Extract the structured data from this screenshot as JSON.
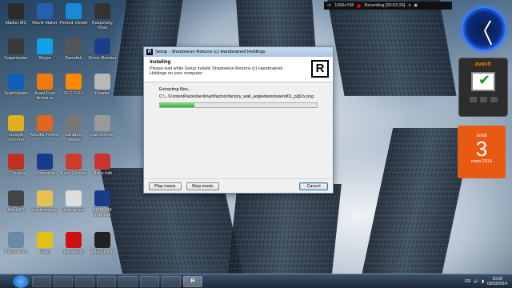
{
  "desktop": {
    "icons": [
      {
        "label": "Madou MC",
        "color": "#2a2a2a"
      },
      {
        "label": "Movie Maker",
        "color": "#2560b0"
      },
      {
        "label": "Pinned Viewer",
        "color": "#1a8ad8"
      },
      {
        "label": "Kaspersky Virus",
        "color": "#333333"
      },
      {
        "label": "Sagamaster",
        "color": "#3a3a3a"
      },
      {
        "label": "Skype",
        "color": "#14a0e8"
      },
      {
        "label": "Ramdisk",
        "color": "#555555"
      },
      {
        "label": "Driver Booster",
        "color": "#1b3e8a"
      },
      {
        "label": "TeamViewer",
        "color": "#0e5fb8"
      },
      {
        "label": "Avast Free Antivirus",
        "color": "#f07a10"
      },
      {
        "label": "VLC 2.0.1",
        "color": "#ff8800"
      },
      {
        "label": "Reader",
        "color": "#b8b8b8"
      },
      {
        "label": "Google Chrome",
        "color": "#e0b020"
      },
      {
        "label": "Mozilla Firefox",
        "color": "#e0661a"
      },
      {
        "label": "Sandbox Studio",
        "color": "#777777"
      },
      {
        "label": "manoforever",
        "color": "#999999"
      },
      {
        "label": "CCleaner",
        "color": "#c03020"
      },
      {
        "label": "Photoshop",
        "color": "#1a3a8a"
      },
      {
        "label": "Mario Forever",
        "color": "#d03a2a"
      },
      {
        "label": "Mario Info",
        "color": "#cc3333"
      },
      {
        "label": "UltraISO",
        "color": "#444444"
      },
      {
        "label": "for download",
        "color": "#e8c050"
      },
      {
        "label": "des compte",
        "color": "#dddddd"
      },
      {
        "label": "EMBLEM logo.psd",
        "color": "#1a3a8a"
      },
      {
        "label": "Recycle Bin",
        "color": "#6a8aa8"
      },
      {
        "label": "Fraps",
        "color": "#e0c010"
      },
      {
        "label": "Bandicam",
        "color": "#d01010"
      },
      {
        "label": "WELCOME",
        "color": "#222222"
      }
    ]
  },
  "recording": {
    "resolution": "1366x768",
    "status": "Recording [00:02:26]"
  },
  "calendar": {
    "day": "lundi",
    "date": "3",
    "month_year": "mars 2014"
  },
  "avast": {
    "brand": "avast!"
  },
  "installer": {
    "title": "Setup - Shadowrun Returns (c) Harebrained Holdings",
    "logo": "R",
    "header_title": "Installing",
    "header_subtitle": "Please wait while Setup installs Shadowrun Returns (c) Harebrained Holdings on your computer.",
    "status": "Extracting files...",
    "path": "C:\\...\\ContentPacks\\berlin\\art\\factory\\factory_wall_angledwindowend01_p@2x.png",
    "progress": 0.22,
    "buttons": {
      "play_music": "Play music",
      "stop_music": "Stop music",
      "cancel": "Cancel"
    }
  },
  "taskbar": {
    "items": [
      "",
      "",
      "",
      "",
      "",
      "",
      "",
      "R"
    ],
    "language": "FR",
    "time": "10:26",
    "date": "03/03/2014"
  }
}
